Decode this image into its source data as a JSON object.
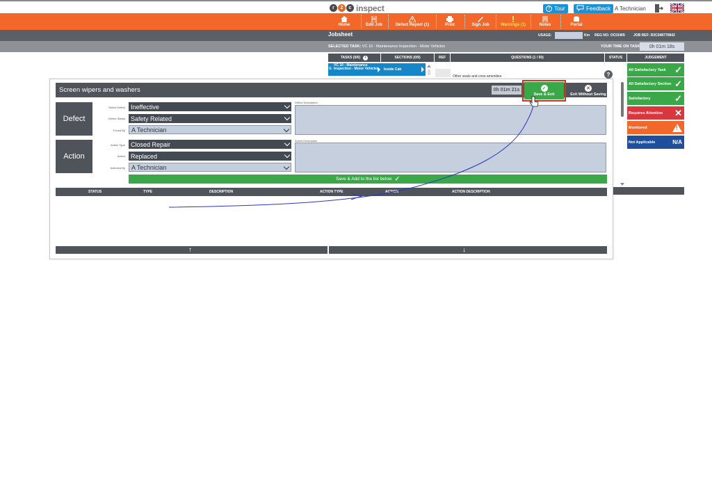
{
  "header": {
    "logo_text": "inspect",
    "logo_letters": [
      "r",
      "2",
      "c"
    ],
    "tour_label": "Tour",
    "feedback_label": "Feedback",
    "user_name": "A Technician"
  },
  "nav": {
    "items": [
      {
        "label": "Home",
        "icon": "home-icon"
      },
      {
        "label": "Edit Job",
        "icon": "edit-document-icon"
      },
      {
        "label": "Defect Report (1)",
        "icon": "warning-triangle-icon"
      },
      {
        "label": "Print",
        "icon": "printer-icon"
      },
      {
        "label": "Sign Job",
        "icon": "pen-icon"
      },
      {
        "label": "Warnings (1)",
        "icon": "exclamation-icon"
      },
      {
        "label": "Notes",
        "icon": "notepad-icon"
      },
      {
        "label": "Portal",
        "icon": "portal-icon"
      }
    ],
    "warnings_color": "#ffe14d"
  },
  "jobsheet": {
    "title": "Jobsheet",
    "usage_label": "USAGE:",
    "usage_unit": "Km",
    "reg_no": "REG NO: OC01WS",
    "job_ref": "JOB REF: R2C048770842",
    "selected_task_label": "SELECTED TASK:",
    "selected_task_value": "VC 10 - Maintenance Inspection - Motor Vehicles",
    "time_label": "YOUR TIME ON TASK:",
    "time_value": "0h 01m 18s"
  },
  "task_table": {
    "headers": {
      "tasks": "TASKS (0/6)",
      "sections": "SECTIONS (0/9)",
      "ref": "REF",
      "questions": "QUESTIONS (1 / 50)",
      "status": "STATUS",
      "judgement": "JUDGEMENT"
    },
    "task_cell": "VC 10 - Maintenance Inspection - Motor Vehicles",
    "task_prefix": "G",
    "section_cell": "Inside Cab",
    "question_text": "Other seats and crew amenities"
  },
  "judgement": [
    {
      "label": "All Satisfactory Task",
      "mark": "✓",
      "color": "#3aa848"
    },
    {
      "label": "All Satisfactory Section",
      "mark": "✓",
      "color": "#3aa848"
    },
    {
      "label": "Satisfactory",
      "mark": "✓",
      "color": "#3aa848"
    },
    {
      "label": "Requires Attention",
      "mark": "✕",
      "color": "#d9363e"
    },
    {
      "label": "Monitored",
      "mark": "!",
      "color": "#f2672a"
    },
    {
      "label": "Not Applicable",
      "mark": "N/A",
      "color": "#1f4e9c"
    }
  ],
  "modal": {
    "title": "Screen wipers and washers",
    "timer": "0h 01m 21s",
    "save_exit_label": "Save & Exit",
    "exit_without_saving_label": "Exit Without Saving",
    "defect": {
      "section_label": "Defect",
      "fields": [
        {
          "label": "Select Defect",
          "value": "Ineffective",
          "style": "dark"
        },
        {
          "label": "Defect Status",
          "value": "Safety Related",
          "style": "dark"
        },
        {
          "label": "Found By",
          "value": "A Technician",
          "style": "light"
        }
      ],
      "description_label": "Defect Description",
      "description_value": ""
    },
    "action": {
      "section_label": "Action",
      "fields": [
        {
          "label": "Action Type",
          "value": "Closed Repair",
          "style": "dark"
        },
        {
          "label": "Action",
          "value": "Replaced",
          "style": "dark"
        },
        {
          "label": "Actioned By",
          "value": "A Technician",
          "style": "light"
        }
      ],
      "description_label": "Action Description",
      "description_value": ""
    },
    "save_add_label": "Save & Add to the list below",
    "list_headers": [
      "STATUS",
      "TYPE",
      "DESCRIPTION",
      "ACTION TYPE",
      "ACTION",
      "ACTION DESCRIPTION"
    ],
    "list_rows": []
  },
  "colors": {
    "orange_nav": "#f2672a",
    "dark_panel": "#4f545b",
    "green": "#3aa848",
    "blue_task": "#1587c8",
    "highlight_red": "#d0312d"
  }
}
